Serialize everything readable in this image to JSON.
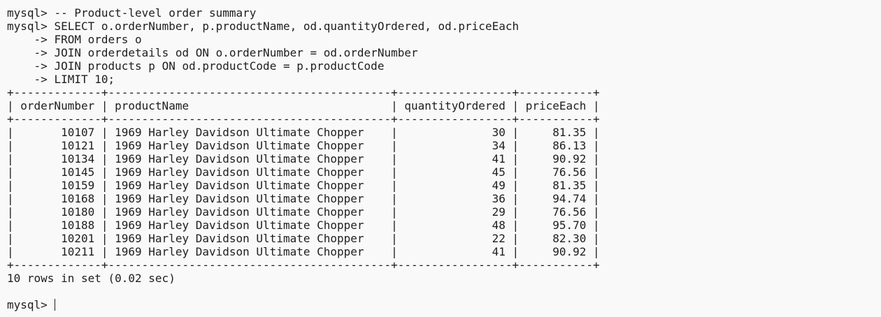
{
  "session": {
    "prompt": "mysql> ",
    "continuation": "    -> ",
    "comment": "-- Product-level order summary",
    "query": [
      "SELECT o.orderNumber, p.productName, od.quantityOrdered, od.priceEach",
      "FROM orders o",
      "JOIN orderdetails od ON o.orderNumber = od.orderNumber",
      "JOIN products p ON od.productCode = p.productCode",
      "LIMIT 10;"
    ]
  },
  "result": {
    "border": "+-------------+------------------------------------------+-----------------+-----------+",
    "header": "| orderNumber | productName                              | quantityOrdered | priceEach |",
    "columns": [
      "orderNumber",
      "productName",
      "quantityOrdered",
      "priceEach"
    ],
    "rows": [
      {
        "orderNumber": "10107",
        "productName": "1969 Harley Davidson Ultimate Chopper",
        "quantityOrdered": "30",
        "priceEach": "81.35",
        "text": "|       10107 | 1969 Harley Davidson Ultimate Chopper    |              30 |     81.35 |"
      },
      {
        "orderNumber": "10121",
        "productName": "1969 Harley Davidson Ultimate Chopper",
        "quantityOrdered": "34",
        "priceEach": "86.13",
        "text": "|       10121 | 1969 Harley Davidson Ultimate Chopper    |              34 |     86.13 |"
      },
      {
        "orderNumber": "10134",
        "productName": "1969 Harley Davidson Ultimate Chopper",
        "quantityOrdered": "41",
        "priceEach": "90.92",
        "text": "|       10134 | 1969 Harley Davidson Ultimate Chopper    |              41 |     90.92 |"
      },
      {
        "orderNumber": "10145",
        "productName": "1969 Harley Davidson Ultimate Chopper",
        "quantityOrdered": "45",
        "priceEach": "76.56",
        "text": "|       10145 | 1969 Harley Davidson Ultimate Chopper    |              45 |     76.56 |"
      },
      {
        "orderNumber": "10159",
        "productName": "1969 Harley Davidson Ultimate Chopper",
        "quantityOrdered": "49",
        "priceEach": "81.35",
        "text": "|       10159 | 1969 Harley Davidson Ultimate Chopper    |              49 |     81.35 |"
      },
      {
        "orderNumber": "10168",
        "productName": "1969 Harley Davidson Ultimate Chopper",
        "quantityOrdered": "36",
        "priceEach": "94.74",
        "text": "|       10168 | 1969 Harley Davidson Ultimate Chopper    |              36 |     94.74 |"
      },
      {
        "orderNumber": "10180",
        "productName": "1969 Harley Davidson Ultimate Chopper",
        "quantityOrdered": "29",
        "priceEach": "76.56",
        "text": "|       10180 | 1969 Harley Davidson Ultimate Chopper    |              29 |     76.56 |"
      },
      {
        "orderNumber": "10188",
        "productName": "1969 Harley Davidson Ultimate Chopper",
        "quantityOrdered": "48",
        "priceEach": "95.70",
        "text": "|       10188 | 1969 Harley Davidson Ultimate Chopper    |              48 |     95.70 |"
      },
      {
        "orderNumber": "10201",
        "productName": "1969 Harley Davidson Ultimate Chopper",
        "quantityOrdered": "22",
        "priceEach": "82.30",
        "text": "|       10201 | 1969 Harley Davidson Ultimate Chopper    |              22 |     82.30 |"
      },
      {
        "orderNumber": "10211",
        "productName": "1969 Harley Davidson Ultimate Chopper",
        "quantityOrdered": "41",
        "priceEach": "90.92",
        "text": "|       10211 | 1969 Harley Davidson Ultimate Chopper    |              41 |     90.92 |"
      }
    ],
    "summary": "10 rows in set (0.02 sec)"
  }
}
